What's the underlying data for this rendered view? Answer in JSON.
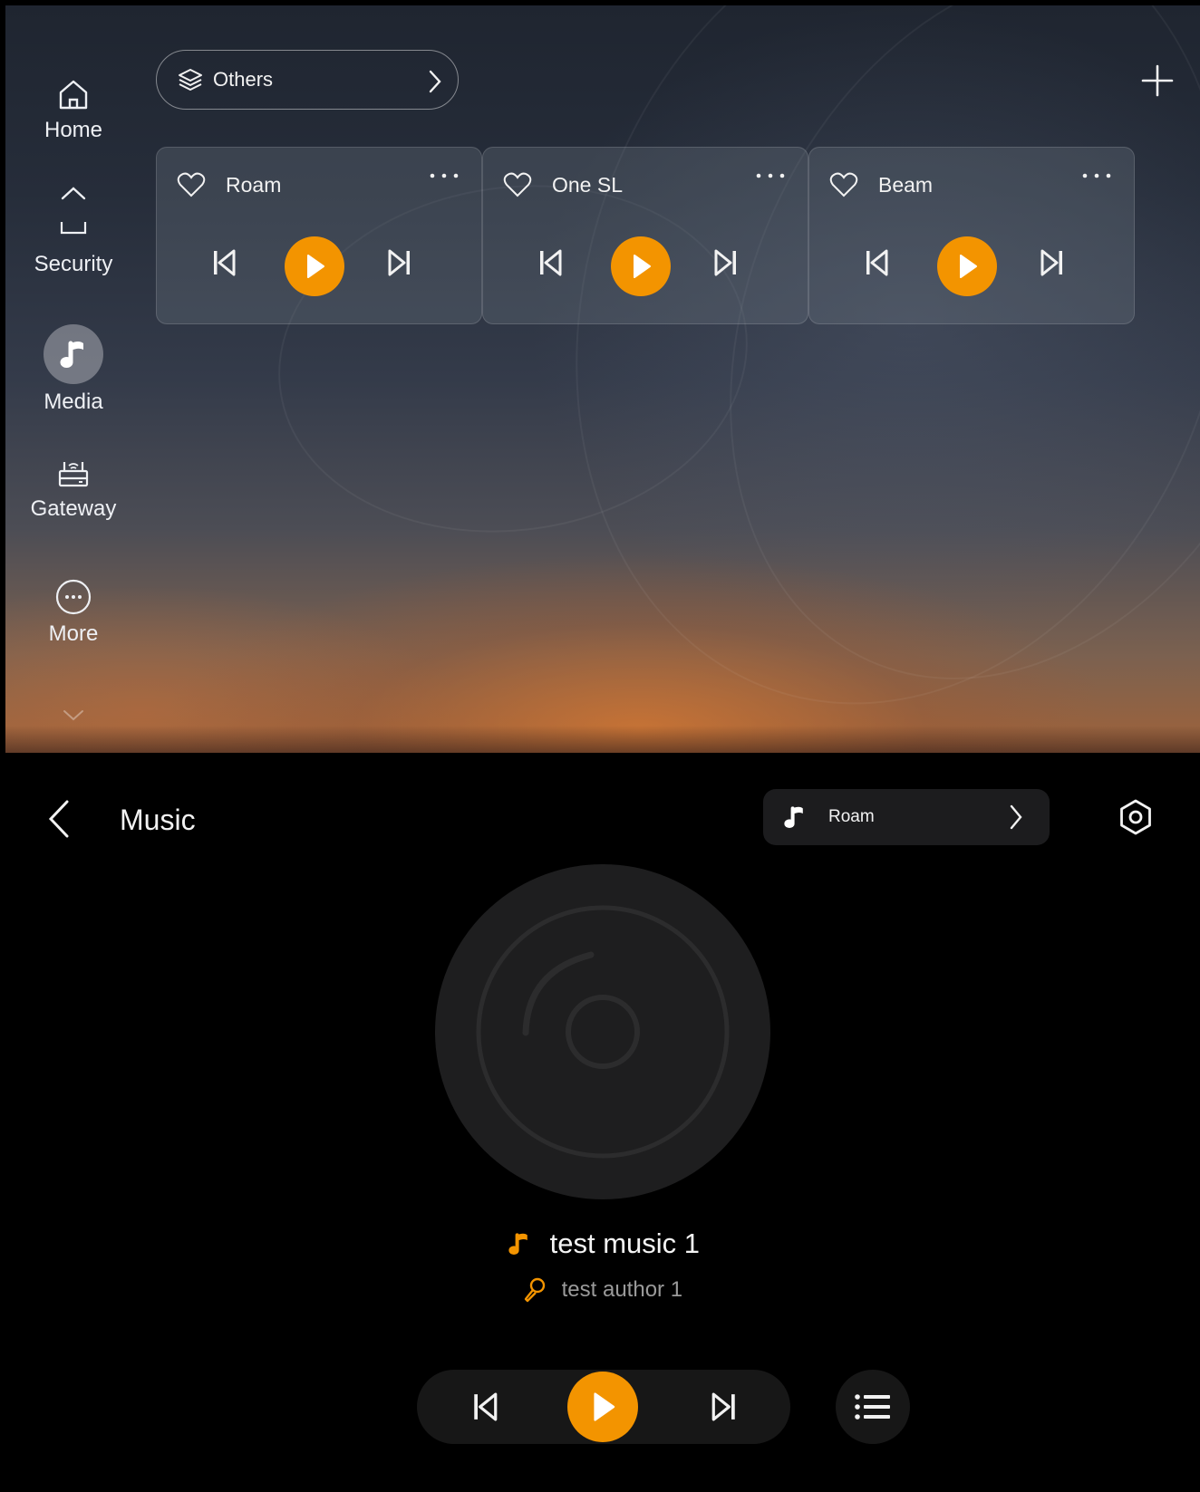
{
  "sidebar": {
    "items": [
      {
        "label": "Home",
        "icon": "home-icon"
      },
      {
        "label": "Security",
        "icon": "security-icon"
      },
      {
        "label": "Media",
        "icon": "music-note-icon"
      },
      {
        "label": "Gateway",
        "icon": "gateway-router-icon"
      },
      {
        "label": "More",
        "icon": "more-dots-icon"
      }
    ],
    "scroll_up_icon": "chevron-up-icon",
    "scroll_down_icon": "chevron-down-icon"
  },
  "group_selector": {
    "label": "Others",
    "icon": "layers-icon",
    "chevron_icon": "chevron-right-icon"
  },
  "add_button_icon": "plus-icon",
  "speakers": [
    {
      "name": "Roam",
      "favorite": false
    },
    {
      "name": "One SL",
      "favorite": false
    },
    {
      "name": "Beam",
      "favorite": false
    }
  ],
  "music_page": {
    "title": "Music",
    "back_icon": "chevron-left-icon",
    "device_selector": {
      "label": "Roam",
      "icon": "music-note-icon"
    },
    "settings_icon": "hexagon-settings-icon",
    "now_playing": {
      "title": "test music 1",
      "author": "test author 1"
    },
    "controls": [
      "previous-icon",
      "play-icon",
      "next-icon"
    ],
    "playlist_icon": "playlist-icon"
  },
  "colors": {
    "accent": "#f39400",
    "panel_dark": "#171717",
    "text_primary": "#f2f2f2",
    "text_secondary": "#9a9a9a"
  }
}
